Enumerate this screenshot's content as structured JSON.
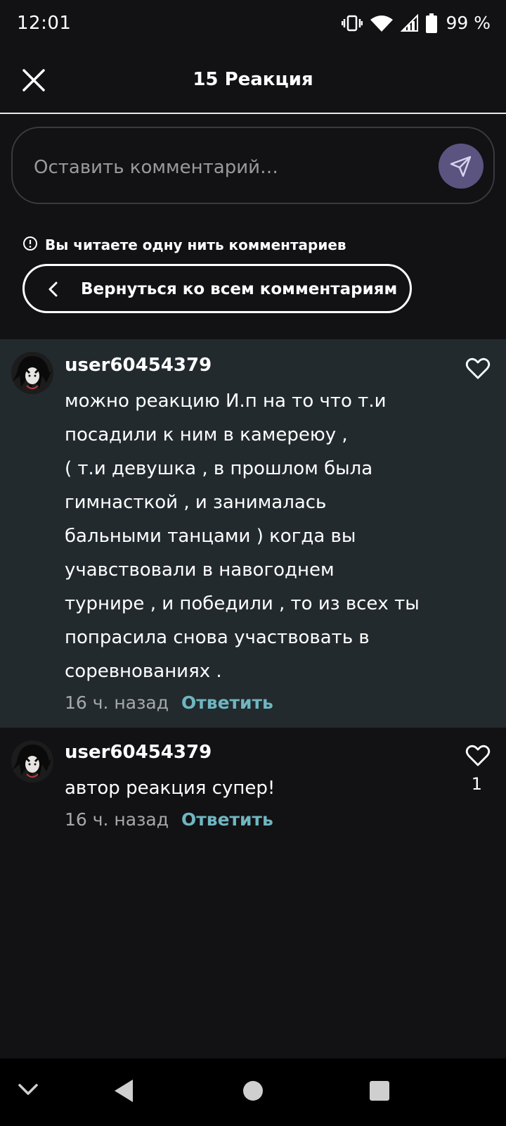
{
  "status_bar": {
    "time": "12:01",
    "battery": "99 %"
  },
  "header": {
    "title": "15 Реакция"
  },
  "comment_input": {
    "placeholder": "Оставить комментарий…"
  },
  "thread": {
    "notice": "Вы читаете одну нить комментариев",
    "back_label": "Вернуться ко всем комментариям"
  },
  "comments": [
    {
      "username": "user60454379",
      "text": "можно реакцию И.п на то что т.и посадили к ним в камереюу ,\n( т.и девушка , в прошлом была гимнасткой , и занималась бальными танцами ) когда вы учавствовали в навогоднем турнире , и победили , то из всех ты попрасила снова участвовать в соревнованиях .",
      "lines": [
        "можно реакцию И.п на то что т.и",
        "посадили к ним в камереюу ,",
        "( т.и девушка , в прошлом была",
        "гимнасткой , и занималась",
        "бальными танцами ) когда вы",
        "учавствовали в навогоднем",
        "турнире , и победили , то из всех ты",
        "попрасила снова участвовать в",
        "соревнованиях ."
      ],
      "time": "16 ч. назад",
      "reply_label": "Ответить",
      "likes": ""
    },
    {
      "username": "user60454379",
      "lines": [
        "автор реакция супер!"
      ],
      "time": "16 ч. назад",
      "reply_label": "Ответить",
      "likes": "1"
    }
  ],
  "colors": {
    "background": "#121114",
    "highlight": "#222a2e",
    "reply": "#6fb6c0",
    "send_button": "#5b5480"
  }
}
